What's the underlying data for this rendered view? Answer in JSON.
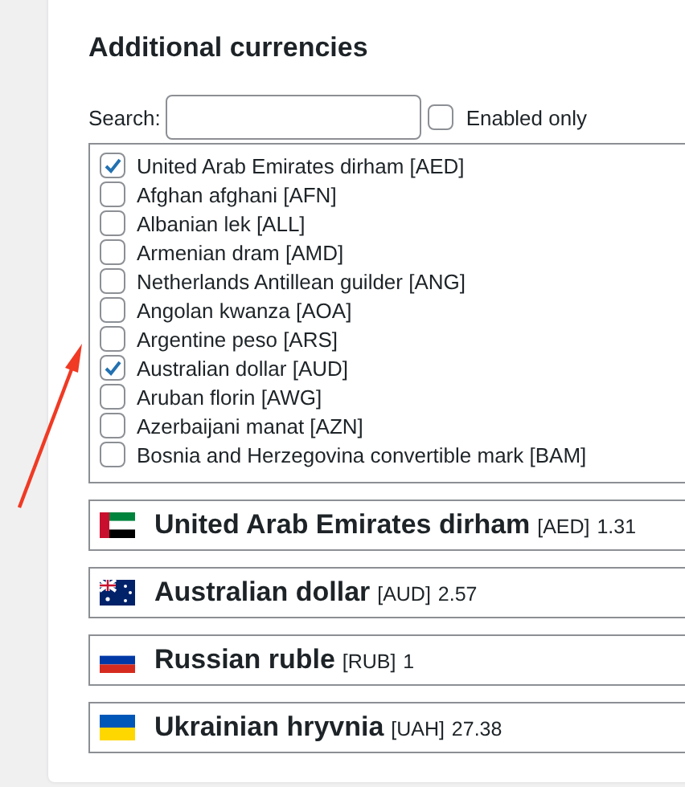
{
  "heading": "Additional currencies",
  "search": {
    "label": "Search:"
  },
  "enabled_only": {
    "label": "Enabled only",
    "checked": false
  },
  "currencies": [
    {
      "label": "United Arab Emirates dirham [AED]",
      "checked": true
    },
    {
      "label": "Afghan afghani [AFN]",
      "checked": false
    },
    {
      "label": "Albanian lek [ALL]",
      "checked": false
    },
    {
      "label": "Armenian dram [AMD]",
      "checked": false
    },
    {
      "label": "Netherlands Antillean guilder [ANG]",
      "checked": false
    },
    {
      "label": "Angolan kwanza [AOA]",
      "checked": false
    },
    {
      "label": "Argentine peso [ARS]",
      "checked": false
    },
    {
      "label": "Australian dollar [AUD]",
      "checked": true
    },
    {
      "label": "Aruban florin [AWG]",
      "checked": false
    },
    {
      "label": "Azerbaijani manat [AZN]",
      "checked": false
    },
    {
      "label": "Bosnia and Herzegovina convertible mark [BAM]",
      "checked": false
    }
  ],
  "enabled": [
    {
      "kind": "uae",
      "name": "United Arab Emirates dirham",
      "code": "[AED]",
      "rate": "1.31"
    },
    {
      "kind": "australia",
      "name": "Australian dollar",
      "code": "[AUD]",
      "rate": "2.57"
    },
    {
      "kind": "russia",
      "name": "Russian ruble",
      "code": "[RUB]",
      "rate": "1"
    },
    {
      "kind": "ukraine",
      "name": "Ukrainian hryvnia",
      "code": "[UAH]",
      "rate": "27.38"
    }
  ]
}
